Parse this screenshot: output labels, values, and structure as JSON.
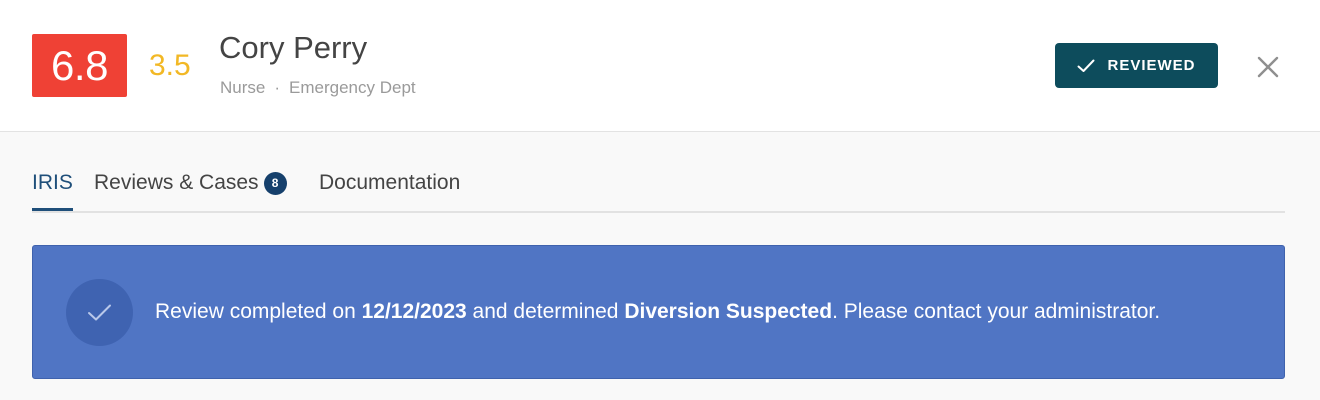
{
  "header": {
    "primary_score": "6.8",
    "secondary_score": "3.5",
    "name": "Cory Perry",
    "role": "Nurse",
    "separator": "·",
    "department": "Emergency Dept",
    "reviewed_label": "REVIEWED",
    "reviewed_icon": "check-icon",
    "close_icon": "close-icon"
  },
  "tabs": [
    {
      "label": "IRIS",
      "active": true
    },
    {
      "label": "Reviews & Cases",
      "badge": "8",
      "active": false
    },
    {
      "label": "Documentation",
      "active": false
    }
  ],
  "banner": {
    "icon": "check-circle-icon",
    "text_prefix": "Review completed on ",
    "date": "12/12/2023",
    "text_middle": " and determined ",
    "determination": "Diversion Suspected",
    "text_suffix": ". Please contact your administrator."
  },
  "colors": {
    "primary_score_bg": "#ef4135",
    "secondary_score": "#f2b825",
    "reviewed_button_bg": "#0d4c5c",
    "active_tab": "#1f4f7a",
    "banner_bg": "#5075c4"
  }
}
